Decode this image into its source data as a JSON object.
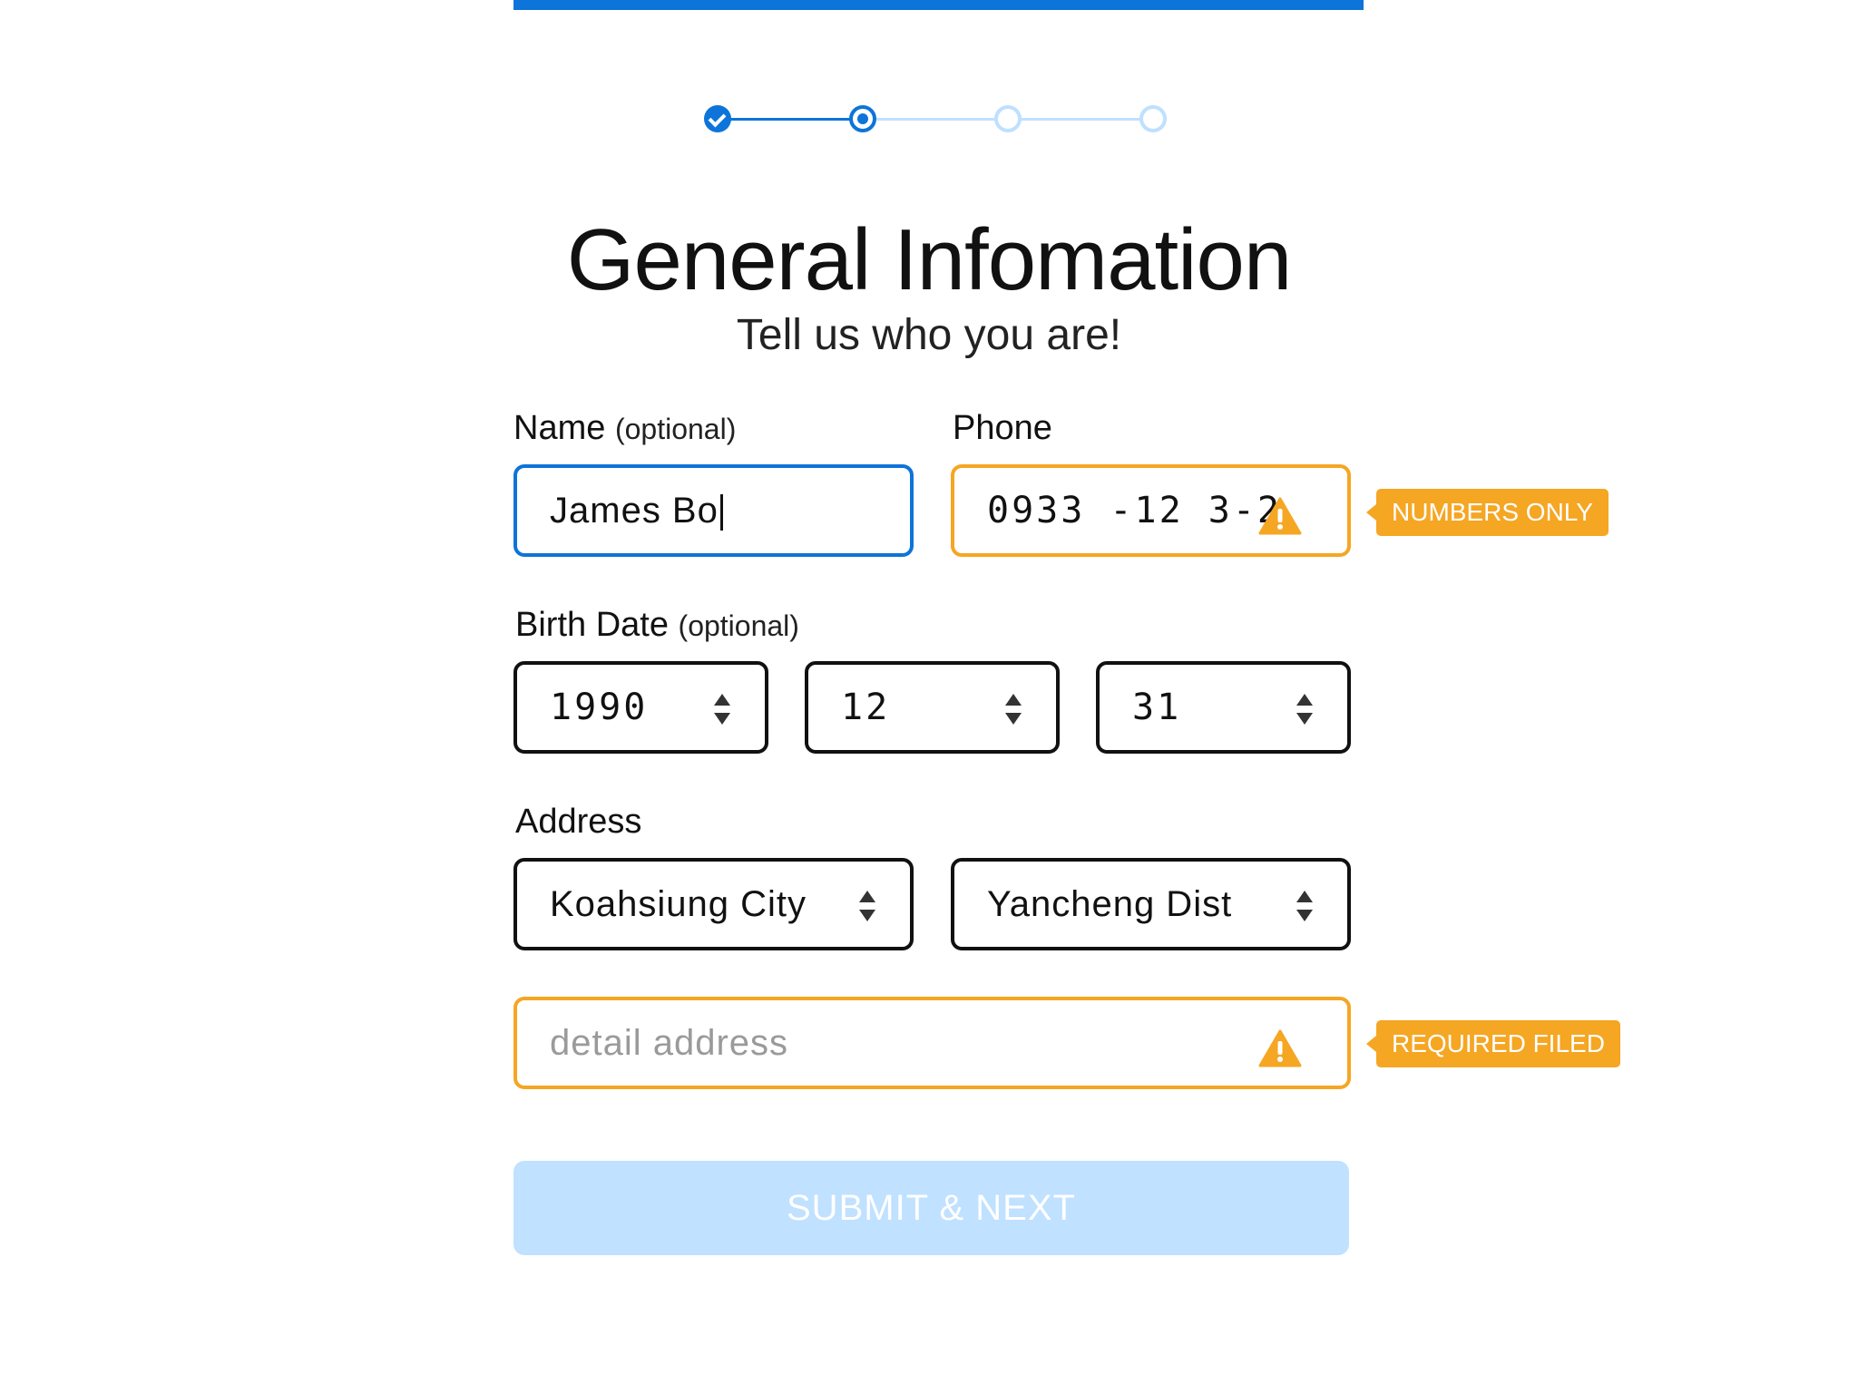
{
  "stepper": {
    "steps": [
      {
        "state": "complete"
      },
      {
        "state": "current"
      },
      {
        "state": "pending"
      },
      {
        "state": "pending"
      }
    ]
  },
  "header": {
    "title": "General Infomation",
    "subtitle": "Tell us who you are!"
  },
  "form": {
    "name": {
      "label": "Name",
      "optional": "(optional)",
      "value": "James Bo"
    },
    "phone": {
      "label": "Phone",
      "value": "0933 -12 3-2",
      "warning": "NUMBERS ONLY"
    },
    "birth_date": {
      "label": "Birth Date",
      "optional": "(optional)",
      "year": "1990",
      "month": "12",
      "day": "31"
    },
    "address": {
      "label": "Address",
      "city": "Koahsiung City",
      "district": "Yancheng Dist",
      "detail_placeholder": "detail address",
      "warning": "REQUIRED FILED"
    },
    "submit_label": "SUBMIT & NEXT"
  },
  "colors": {
    "primary": "#0d74d9",
    "primary_light": "#bfe0ff",
    "warning": "#f5a623",
    "button_disabled": "#c0e1ff"
  }
}
